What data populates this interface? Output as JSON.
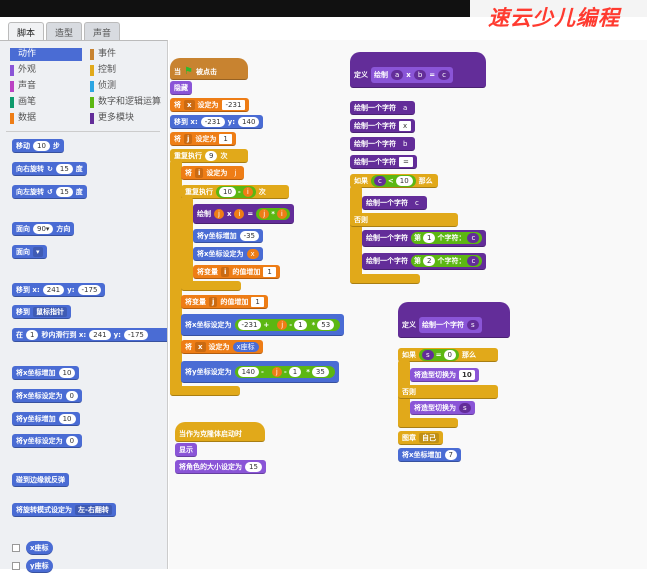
{
  "brand": "速云少儿编程",
  "tabs": [
    "脚本",
    "造型",
    "声音"
  ],
  "categories": [
    {
      "label": "动作",
      "color": "#4a6cd4"
    },
    {
      "label": "事件",
      "color": "#c88330"
    },
    {
      "label": "外观",
      "color": "#8a55d7"
    },
    {
      "label": "控制",
      "color": "#e1a91a"
    },
    {
      "label": "声音",
      "color": "#bb42c3"
    },
    {
      "label": "侦测",
      "color": "#2ca5e2"
    },
    {
      "label": "画笔",
      "color": "#0e9a6c"
    },
    {
      "label": "数字和逻辑运算",
      "color": "#5cb712"
    },
    {
      "label": "数据",
      "color": "#ee7d16"
    },
    {
      "label": "更多模块",
      "color": "#632d99"
    }
  ],
  "palette": {
    "move": {
      "label": "移动",
      "value": "10",
      "unit": "步"
    },
    "turn_right": {
      "label": "向右旋转",
      "icon": "↻",
      "value": "15",
      "unit": "度"
    },
    "turn_left": {
      "label": "向左旋转",
      "icon": "↺",
      "value": "15",
      "unit": "度"
    },
    "point_dir": {
      "label": "面向",
      "value": "90▾",
      "unit": "方向"
    },
    "point_to": {
      "label": "面向",
      "value": "▾"
    },
    "goto_xy": {
      "label": "移到 x:",
      "x": "241",
      "ylabel": "y:",
      "y": "-175"
    },
    "goto": {
      "label": "移到",
      "value": "鼠标指针"
    },
    "glide": {
      "label": "在",
      "secs": "1",
      "mid": "秒内滑行到 x:",
      "x": "241",
      "ylabel": "y:",
      "y": "-175"
    },
    "change_x": {
      "label": "将x坐标增加",
      "value": "10"
    },
    "set_x": {
      "label": "将x坐标设定为",
      "value": "0"
    },
    "change_y": {
      "label": "将y坐标增加",
      "value": "10"
    },
    "set_y": {
      "label": "将y坐标设定为",
      "value": "0"
    },
    "bounce": {
      "label": "碰到边缘就反弹"
    },
    "rotation": {
      "label": "将旋转模式设定为",
      "value": "左-右翻转"
    },
    "xpos": {
      "label": "x座标"
    },
    "ypos": {
      "label": "y座标"
    }
  },
  "main_script": {
    "hat": {
      "label": "当",
      "icon": "flag-icon",
      "suffix": "被点击"
    },
    "hide": "隐藏",
    "set_x": {
      "label": "将",
      "var": "x",
      "mid": "设定为",
      "value": "-231"
    },
    "goto": {
      "label": "移到 x:",
      "x": "-231",
      "ylabel": "y:",
      "y": "140"
    },
    "set_j": {
      "label": "将",
      "var": "j",
      "mid": "设定为",
      "value": "1"
    },
    "repeat_outer": {
      "label": "重复执行",
      "value": "9",
      "unit": "次"
    },
    "set_i": {
      "label": "将",
      "var": "i",
      "mid": "设定为",
      "value": "j"
    },
    "repeat_inner": {
      "label": "重复执行",
      "a": "10",
      "op": "-",
      "b": "i",
      "unit": "次"
    },
    "draw": {
      "label": "绘制",
      "a": "j",
      "x": "x",
      "b": "i",
      "eq": "=",
      "c": "j",
      "op": "*",
      "d": "i"
    },
    "change_y": {
      "label": "将y坐标增加",
      "value": "-35"
    },
    "set_xvar": {
      "label": "将x坐标设定为",
      "value": "x"
    },
    "change_i": {
      "label": "将变量",
      "var": "i",
      "mid": "的值增加",
      "value": "1"
    },
    "change_j": {
      "label": "将变量",
      "var": "j",
      "mid": "的值增加",
      "value": "1"
    },
    "set_x_expr": {
      "label": "将x坐标设定为",
      "a": "-231",
      "op": "+",
      "b": "j",
      "op2": "-",
      "c": "1",
      "op3": "*",
      "d": "53"
    },
    "set_xvar2": {
      "label": "将",
      "var": "x",
      "mid": "设定为",
      "value": "x座标"
    },
    "set_y_expr": {
      "label": "将y坐标设定为",
      "a": "140",
      "op": "-",
      "b": "j",
      "op2": "-",
      "c": "1",
      "op3": "*",
      "d": "35"
    }
  },
  "clone_script": {
    "hat": "当作为克隆体启动时",
    "show": "显示",
    "size": {
      "label": "将角色的大小设定为",
      "value": "15"
    }
  },
  "def_draw": {
    "header": {
      "label": "定义",
      "name": "绘制",
      "a": "a",
      "x": "x",
      "b": "b",
      "eq": "=",
      "c": "c"
    },
    "lines": [
      {
        "label": "绘制一个字符",
        "value": "a"
      },
      {
        "label": "绘制一个字符",
        "value": "x"
      },
      {
        "label": "绘制一个字符",
        "value": "b"
      },
      {
        "label": "绘制一个字符",
        "value": "="
      }
    ],
    "if": {
      "label": "如果",
      "a": "c",
      "op": "<",
      "b": "10",
      "suffix": "那么"
    },
    "then": {
      "label": "绘制一个字符",
      "value": "c"
    },
    "else": "否则",
    "else_lines": [
      {
        "label": "绘制一个字符",
        "pre": "第",
        "n": "1",
        "post": "个字符：",
        "v": "c"
      },
      {
        "label": "绘制一个字符",
        "pre": "第",
        "n": "2",
        "post": "个字符：",
        "v": "c"
      }
    ]
  },
  "def_char": {
    "header": {
      "label": "定义",
      "name": "绘制一个字符",
      "s": "s"
    },
    "if": {
      "label": "如果",
      "a": "s",
      "op": "=",
      "b": "0",
      "suffix": "那么"
    },
    "then": {
      "label": "将造型切换为",
      "value": "10"
    },
    "else": "否则",
    "else_line": {
      "label": "将造型切换为",
      "value": "s"
    },
    "stamp": {
      "label": "图章",
      "value": "自己"
    },
    "change_x": {
      "label": "将x坐标增加",
      "value": "7"
    }
  }
}
